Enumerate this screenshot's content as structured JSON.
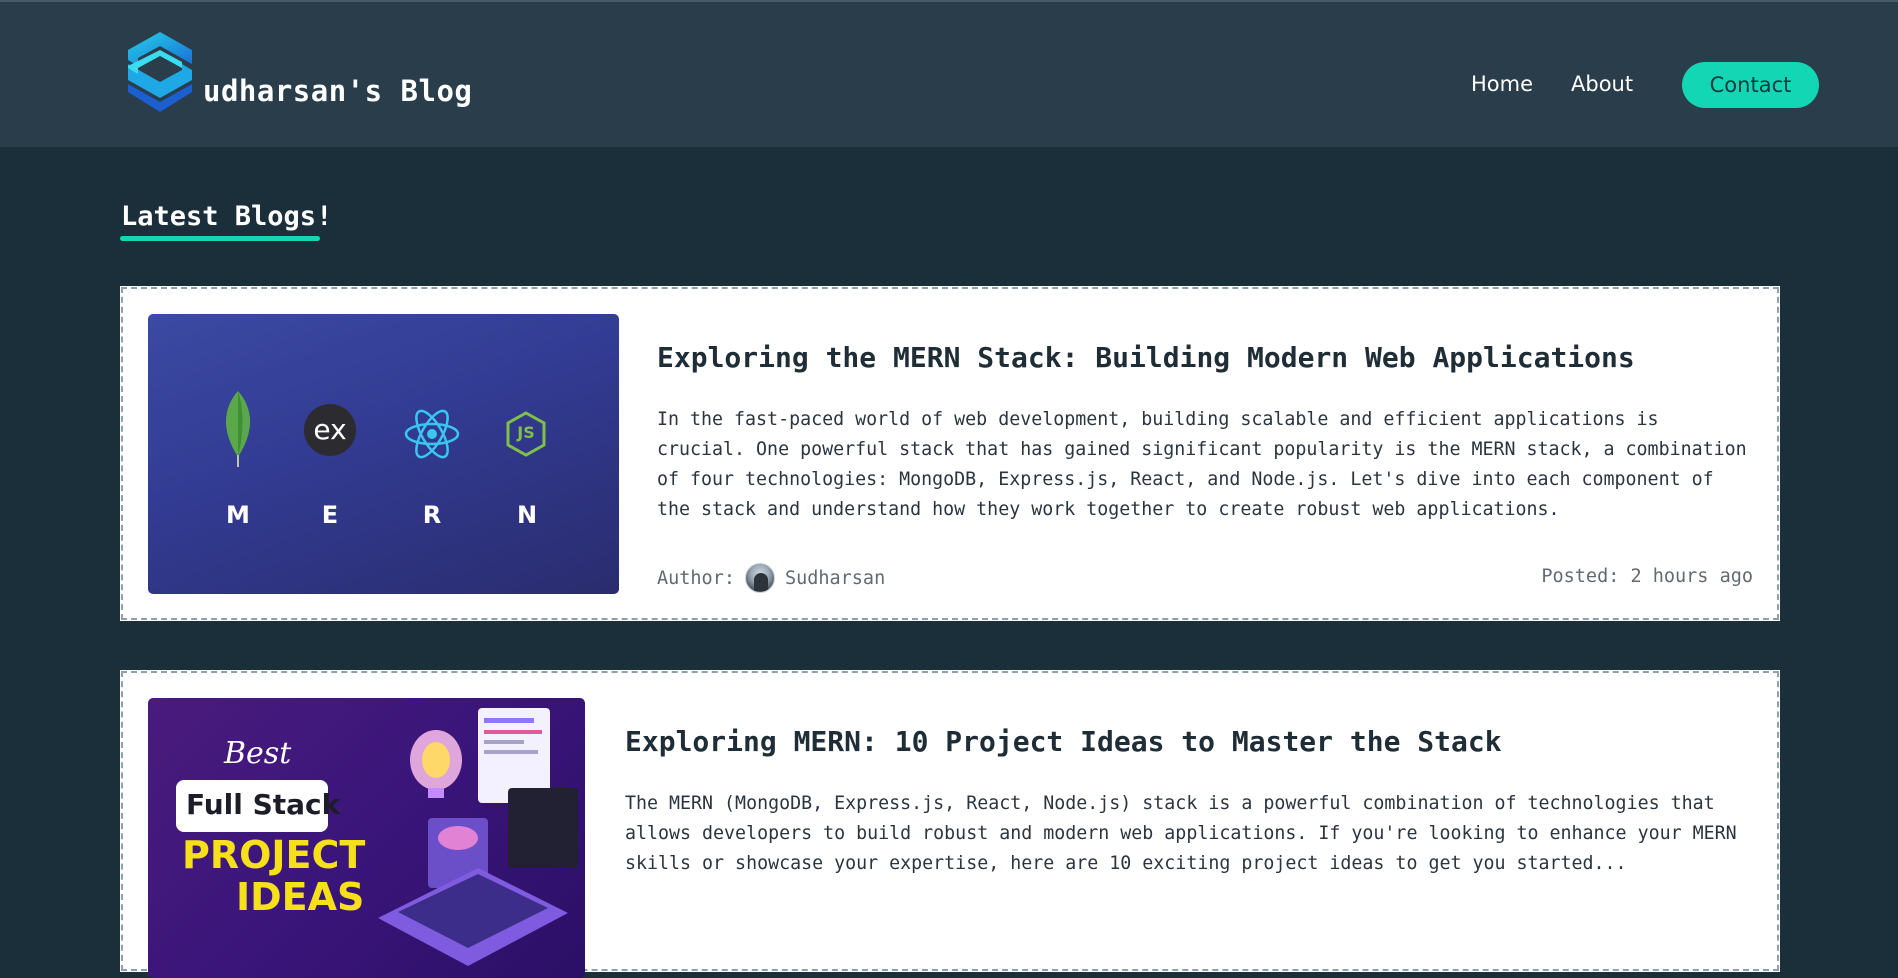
{
  "header": {
    "brand": "udharsan's Blog",
    "nav": {
      "home": "Home",
      "about": "About",
      "contact": "Contact"
    }
  },
  "main": {
    "section_title": "Latest Blogs!",
    "posts": [
      {
        "title": "Exploring the MERN Stack: Building Modern Web Applications",
        "excerpt": "In the fast-paced world of web development, building scalable and efficient applications is crucial. One powerful stack that has gained significant popularity is the MERN stack, a combination of four technologies: MongoDB, Express.js, React, and Node.js. Let's dive into each component of the stack and understand how they work together to create robust web applications.",
        "author_label": "Author:",
        "author": "Sudharsan",
        "posted": "Posted: 2 hours ago",
        "thumb": {
          "letters": [
            "M",
            "E",
            "R",
            "N"
          ],
          "ex_text": "ex",
          "js_text": "JS"
        }
      },
      {
        "title": "Exploring MERN: 10 Project Ideas to Master the Stack",
        "excerpt": "The MERN (MongoDB, Express.js, React, Node.js) stack is a powerful combination of technologies that allows developers to build robust and modern web applications. If you're looking to enhance your MERN skills or showcase your expertise, here are 10 exciting project ideas to get you started...",
        "thumb": {
          "line1": "Best",
          "line2": "Full Stack",
          "line3": "PROJECT",
          "line4": "IDEAS"
        }
      }
    ]
  },
  "colors": {
    "background": "#1b2f3b",
    "header": "#293d4b",
    "accent": "#13d6b4"
  }
}
